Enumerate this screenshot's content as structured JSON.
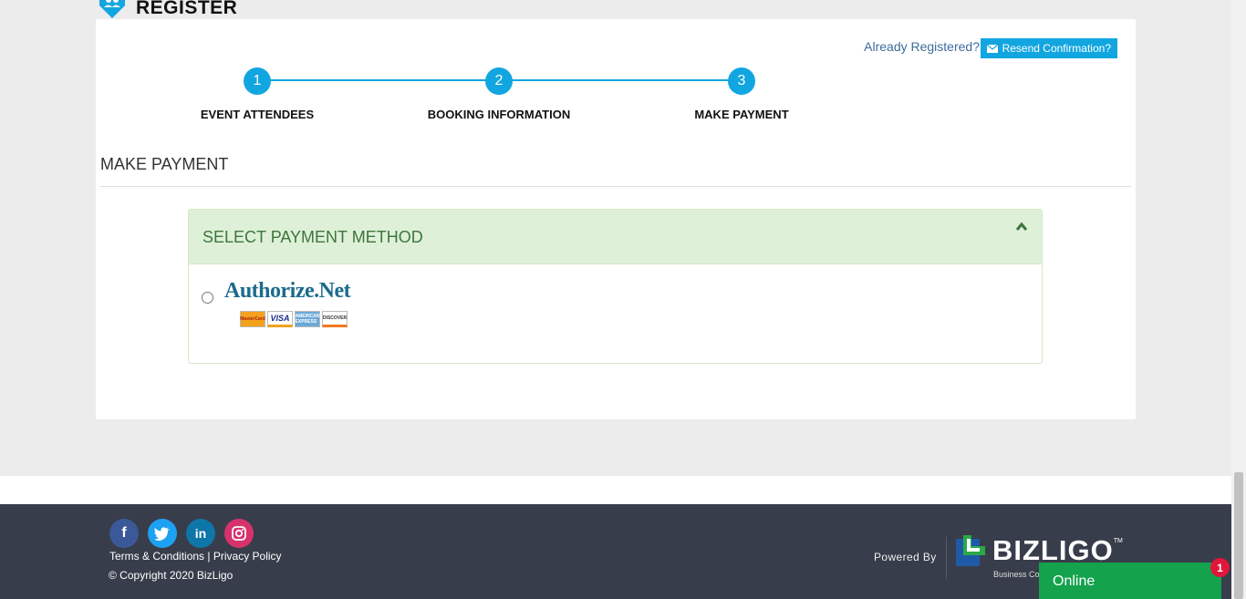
{
  "header": {
    "title": "REGISTER"
  },
  "topbar": {
    "already_registered": "Already Registered?",
    "resend_label": "Resend Confirmation?"
  },
  "steps": [
    {
      "number": "1",
      "label": "EVENT ATTENDEES"
    },
    {
      "number": "2",
      "label": "BOOKING INFORMATION"
    },
    {
      "number": "3",
      "label": "MAKE PAYMENT"
    }
  ],
  "section": {
    "title": "MAKE PAYMENT"
  },
  "payment_panel": {
    "title": "SELECT PAYMENT METHOD",
    "option_logo": "Authorize.Net",
    "card_brands": [
      "MasterCard",
      "VISA",
      "AMERICAN EXPRESS",
      "DISCOVER"
    ]
  },
  "footer": {
    "socials": [
      "facebook-icon",
      "twitter-icon",
      "linkedin-icon",
      "instagram-icon"
    ],
    "terms": "Terms & Conditions",
    "separator": "|",
    "privacy": "Privacy Policy",
    "copyright": "© Copyright 2020 BizLigo",
    "powered_by": "Powered By",
    "brand": "BIZLIGO",
    "brand_tm": "TM",
    "brand_sub": "Business Co"
  },
  "chat": {
    "label": "Online",
    "badge": "1"
  },
  "colors": {
    "accent": "#12a6e0",
    "panel_head": "#dff0d8",
    "panel_text": "#3c763d",
    "footer_bg": "#383d4b",
    "chat_bg": "#14a24d"
  }
}
